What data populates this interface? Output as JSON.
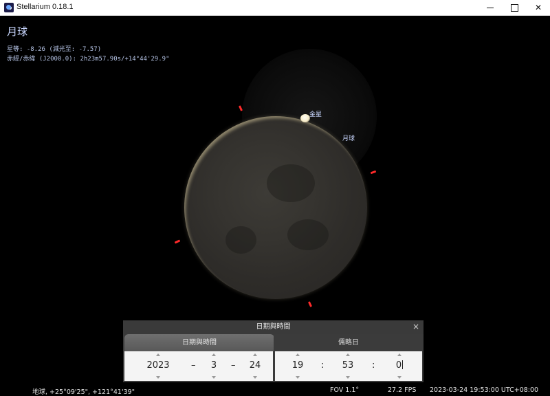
{
  "window": {
    "title": "Stellarium 0.18.1"
  },
  "object": {
    "name": "月球",
    "magnitude_line": "星等: -8.26 (減光至: -7.57)",
    "radec_line": "赤經/赤緯 (J2000.0): 2h23m57.90s/+14°44'29.9\""
  },
  "sky_labels": {
    "venus": "金星",
    "moon": "月球"
  },
  "dialog": {
    "title": "日期與時間",
    "close_icon": "×",
    "tabs": [
      {
        "label": "日期與時間",
        "active": true
      },
      {
        "label": "儒略日",
        "active": false
      }
    ],
    "date": {
      "year": "2023",
      "month": "3",
      "day": "24",
      "separator": "–"
    },
    "time": {
      "hour": "19",
      "minute": "53",
      "second": "0",
      "separator": ":"
    }
  },
  "statusbar": {
    "location": "地球, +25°09'25\", +121°41'39\"",
    "fov": "FOV 1.1°",
    "fps": "27.2 FPS",
    "datetime": "2023-03-24 19:53:00 UTC+08:00"
  },
  "colors": {
    "label_blue": "#c9d7ff",
    "pointer_red": "#ff2a2a",
    "dialog_bg": "#3e3e3e"
  }
}
